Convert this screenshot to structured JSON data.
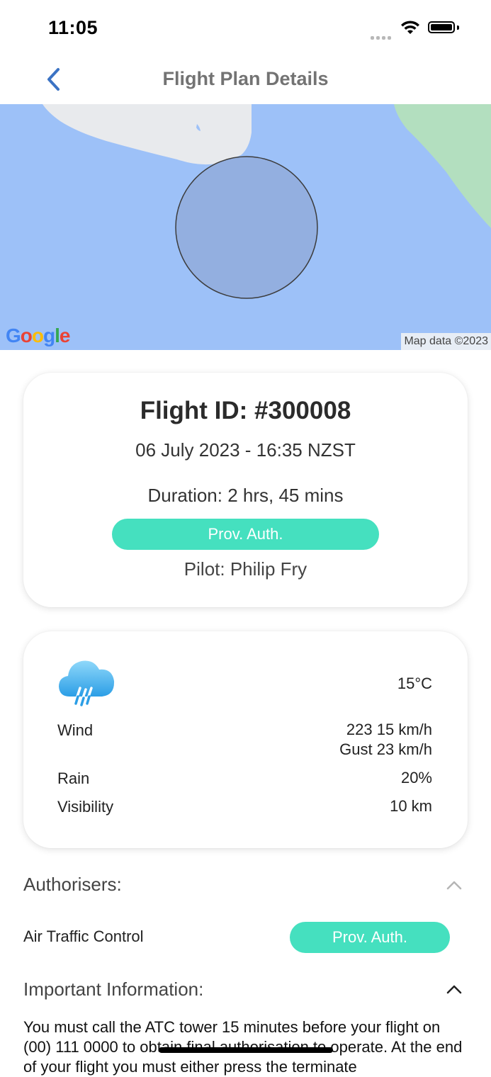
{
  "status_bar": {
    "time": "11:05"
  },
  "nav": {
    "title": "Flight Plan Details"
  },
  "map": {
    "google": "Google",
    "attribution": "Map data ©2023"
  },
  "flight": {
    "id": "Flight ID: #300008",
    "date": "06 July 2023 - 16:35 NZST",
    "duration": "Duration: 2 hrs, 45 mins",
    "status": "Prov. Auth.",
    "pilot": "Pilot: Philip Fry"
  },
  "weather": {
    "icon": "rain-cloud-icon",
    "temperature": "15°C",
    "wind_label": "Wind",
    "wind_value": "223 15 km/h",
    "gust_value": "Gust 23 km/h",
    "rain_label": "Rain",
    "rain_value": "20%",
    "visibility_label": "Visibility",
    "visibility_value": "10 km"
  },
  "authorisers": {
    "heading": "Authorisers:",
    "items": [
      {
        "name": "Air Traffic Control",
        "status": "Prov. Auth."
      }
    ]
  },
  "important": {
    "heading": "Important Information:",
    "text": "You must call the ATC tower 15 minutes before your flight on (00) 111 0000 to obtain final authorisation to operate. At the end of your flight you must either press the terminate"
  },
  "colors": {
    "accent": "#45e0bf",
    "map_water": "#9dc1f8",
    "nav_blue": "#3b73c4"
  }
}
